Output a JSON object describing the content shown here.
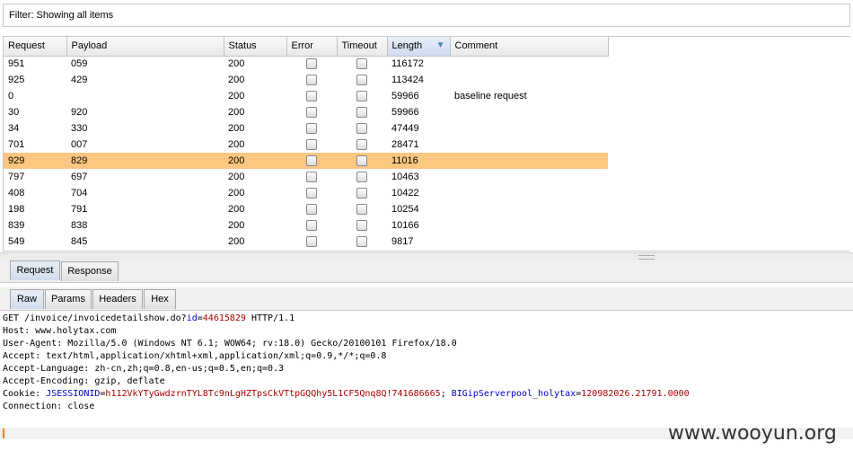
{
  "filter": {
    "text": "Filter:  Showing all items"
  },
  "table": {
    "columns": [
      "Request",
      "Payload",
      "Status",
      "Error",
      "Timeout",
      "Length",
      "Comment"
    ],
    "rows": [
      {
        "request": "951",
        "payload": "059",
        "status": "200",
        "length": "116172",
        "comment": ""
      },
      {
        "request": "925",
        "payload": "429",
        "status": "200",
        "length": "113424",
        "comment": ""
      },
      {
        "request": "0",
        "payload": "",
        "status": "200",
        "length": "59966",
        "comment": "baseline request"
      },
      {
        "request": "30",
        "payload": "920",
        "status": "200",
        "length": "59966",
        "comment": ""
      },
      {
        "request": "34",
        "payload": "330",
        "status": "200",
        "length": "47449",
        "comment": ""
      },
      {
        "request": "701",
        "payload": "007",
        "status": "200",
        "length": "28471",
        "comment": ""
      },
      {
        "request": "929",
        "payload": "829",
        "status": "200",
        "length": "11016",
        "comment": "",
        "selected": true
      },
      {
        "request": "797",
        "payload": "697",
        "status": "200",
        "length": "10463",
        "comment": ""
      },
      {
        "request": "408",
        "payload": "704",
        "status": "200",
        "length": "10422",
        "comment": ""
      },
      {
        "request": "198",
        "payload": "791",
        "status": "200",
        "length": "10254",
        "comment": ""
      },
      {
        "request": "839",
        "payload": "838",
        "status": "200",
        "length": "10166",
        "comment": ""
      },
      {
        "request": "549",
        "payload": "845",
        "status": "200",
        "length": "9817",
        "comment": ""
      }
    ],
    "sort_indicator": "▼"
  },
  "tabs_top": [
    "Request",
    "Response"
  ],
  "tabs_sub": [
    "Raw",
    "Params",
    "Headers",
    "Hex"
  ],
  "raw": {
    "line1_a": "GET /invoice/invoicedetailshow.do?",
    "line1_pname": "id",
    "line1_eq": "=",
    "line1_pval": "44615829",
    "line1_b": " HTTP/1.1",
    "line2": "Host: www.holytax.com",
    "line3": "User-Agent: Mozilla/5.0 (Windows NT 6.1; WOW64; rv:18.0) Gecko/20100101 Firefox/18.0",
    "line4": "Accept: text/html,application/xhtml+xml,application/xml;q=0.9,*/*;q=0.8",
    "line5": "Accept-Language: zh-cn,zh;q=0.8,en-us;q=0.5,en;q=0.3",
    "line6": "Accept-Encoding: gzip, deflate",
    "cookie_label": "Cookie: ",
    "cookie1_name": "JSESSIONID",
    "cookie1_val": "h112VkYTyGwdzrnTYL8Tc9nLgHZTpsCkVTtpGQQhy5L1CF5Qnq8Q!741686665",
    "cookie_sep": "; ",
    "cookie2_name": "BIGipServerpool_holytax",
    "cookie2_val": "120982026.21791.0000",
    "line8": "Connection: close"
  },
  "watermark": "www.wooyun.org"
}
